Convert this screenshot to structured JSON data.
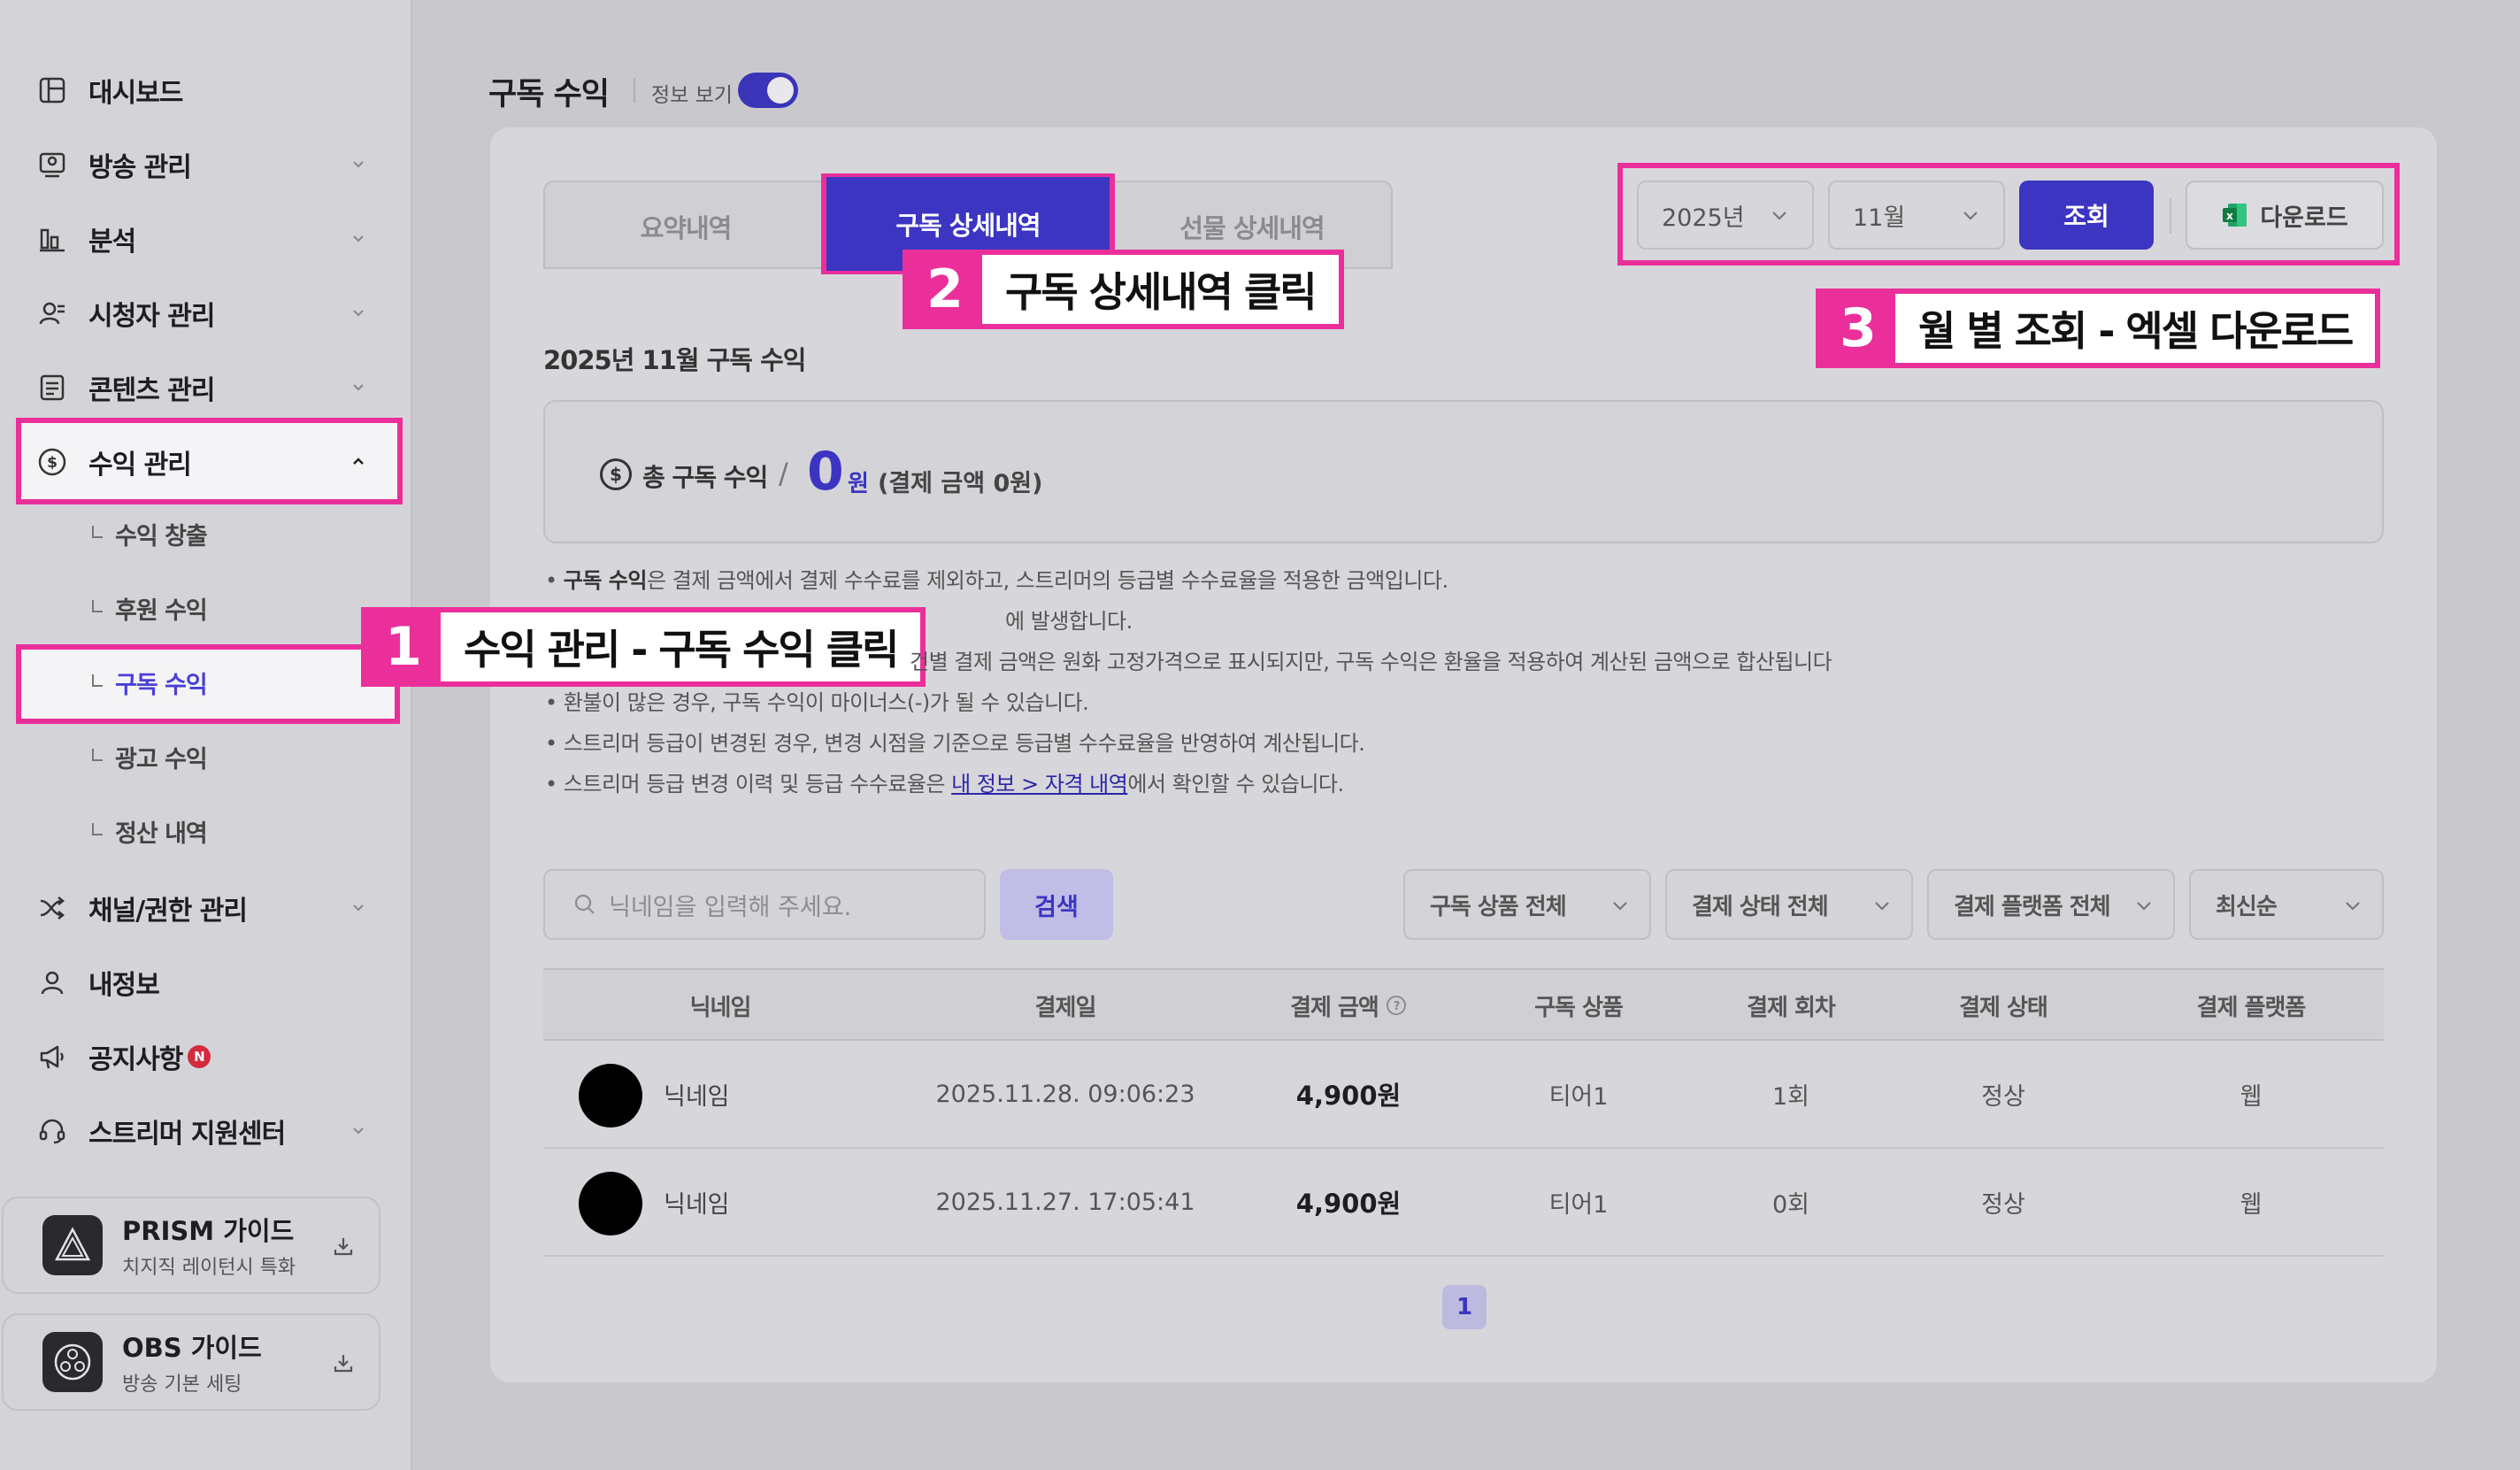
{
  "sidebar": {
    "items": [
      {
        "label": "대시보드",
        "icon": "dashboard-icon"
      },
      {
        "label": "방송 관리",
        "icon": "broadcast-icon"
      },
      {
        "label": "분석",
        "icon": "analytics-icon"
      },
      {
        "label": "시청자 관리",
        "icon": "viewer-icon"
      },
      {
        "label": "콘텐츠 관리",
        "icon": "content-icon"
      },
      {
        "label": "수익 관리",
        "icon": "dollar-icon"
      },
      {
        "label": "채널/권한 관리",
        "icon": "shuffle-icon"
      },
      {
        "label": "내정보",
        "icon": "user-icon"
      },
      {
        "label": "공지사항",
        "icon": "megaphone-icon",
        "badge": "N"
      },
      {
        "label": "스트리머 지원센터",
        "icon": "headset-icon"
      }
    ],
    "subitems": [
      {
        "label": "수익 창출"
      },
      {
        "label": "후원 수익"
      },
      {
        "label": "구독 수익"
      },
      {
        "label": "광고 수익"
      },
      {
        "label": "정산 내역"
      }
    ],
    "guides": [
      {
        "title": "PRISM 가이드",
        "subtitle": "치지직 레이턴시 특화"
      },
      {
        "title": "OBS 가이드",
        "subtitle": "방송 기본 세팅"
      }
    ]
  },
  "header": {
    "title": "구독 수익",
    "info_toggle_label": "정보 보기"
  },
  "tabs": [
    {
      "label": "요약내역"
    },
    {
      "label": "구독 상세내역"
    },
    {
      "label": "선물 상세내역"
    }
  ],
  "controls": {
    "year": "2025년",
    "month": "11월",
    "query_button": "조회",
    "download_button": "다운로드"
  },
  "callouts": [
    {
      "num": "1",
      "text": "수익 관리 - 구독 수익 클릭"
    },
    {
      "num": "2",
      "text": "구독 상세내역 클릭"
    },
    {
      "num": "3",
      "text": "월 별 조회 - 엑셀 다운로드"
    }
  ],
  "summary": {
    "section_title": "2025년 11월 구독 수익",
    "label": "총 구독 수익",
    "value": "0",
    "unit": "원",
    "note": "(결제 금액 0원)"
  },
  "notes": [
    {
      "bold": "구독 수익",
      "text": "은 결제 금액에서 결제 수수료를 제외하고, 스트리머의 등급별 수수료율을 적용한 금액입니다."
    },
    {
      "text": "에 발생합니다."
    },
    {
      "text": "건별 결제 금액은 원화 고정가격으로 표시되지만, 구독 수익은 환율을 적용하여 계산된 금액으로 합산됩니다"
    },
    {
      "text": "환불이 많은 경우, 구독 수익이 마이너스(-)가 될 수 있습니다."
    },
    {
      "text": "스트리머 등급이 변경된 경우, 변경 시점을 기준으로 등급별 수수료율을 반영하여 계산됩니다."
    },
    {
      "text": "스트리머 등급 변경 이력 및 등급 수수료율은 ",
      "link": "내 정보 > 자격 내역",
      "after": "에서 확인할 수 있습니다."
    }
  ],
  "search": {
    "placeholder": "닉네임을 입력해 주세요.",
    "button": "검색"
  },
  "filters": [
    "구독 상품 전체",
    "결제 상태 전체",
    "결제 플랫폼 전체",
    "최신순"
  ],
  "table": {
    "columns": [
      "닉네임",
      "결제일",
      "결제 금액",
      "구독 상품",
      "결제 회차",
      "결제 상태",
      "결제 플랫폼"
    ],
    "rows": [
      {
        "nickname": "닉네임",
        "date": "2025.11.28. 09:06:23",
        "amount": "4,900원",
        "product": "티어1",
        "count": "1회",
        "status": "정상",
        "platform": "웹"
      },
      {
        "nickname": "닉네임",
        "date": "2025.11.27. 17:05:41",
        "amount": "4,900원",
        "product": "티어1",
        "count": "0회",
        "status": "정상",
        "platform": "웹"
      }
    ]
  },
  "pagination": {
    "current": "1"
  },
  "colors": {
    "accent": "#3c35c2",
    "highlight": "#ea2f9a"
  }
}
